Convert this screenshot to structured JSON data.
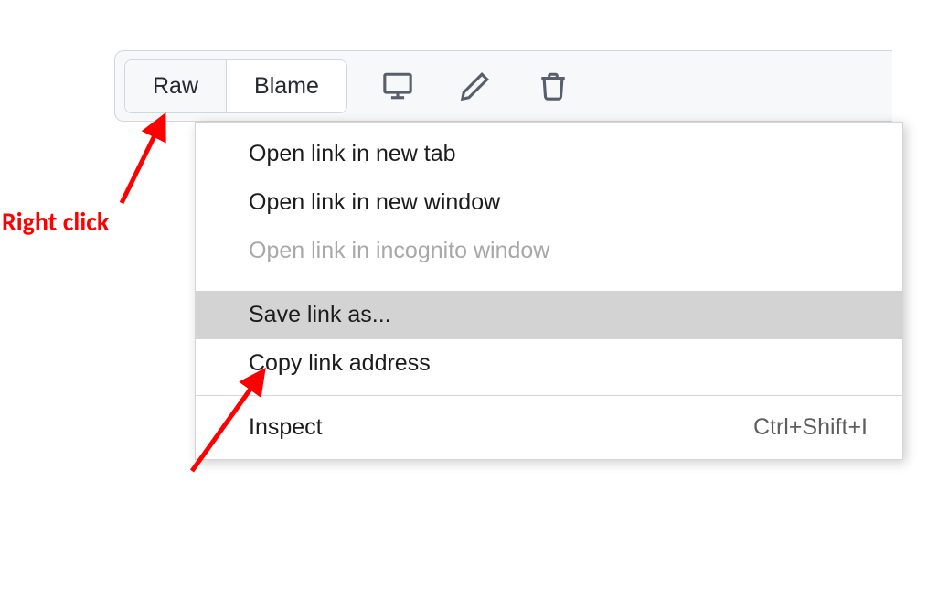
{
  "toolbar": {
    "raw_label": "Raw",
    "blame_label": "Blame"
  },
  "context_menu": {
    "items": [
      {
        "label": "Open link in new tab",
        "disabled": false
      },
      {
        "label": "Open link in new window",
        "disabled": false
      },
      {
        "label": "Open link in incognito window",
        "disabled": true
      }
    ],
    "items2": [
      {
        "label": "Save link as...",
        "highlighted": true
      },
      {
        "label": "Copy link address",
        "highlighted": false
      }
    ],
    "inspect_label": "Inspect",
    "inspect_shortcut": "Ctrl+Shift+I"
  },
  "annotation": {
    "right_click": "Right click"
  }
}
